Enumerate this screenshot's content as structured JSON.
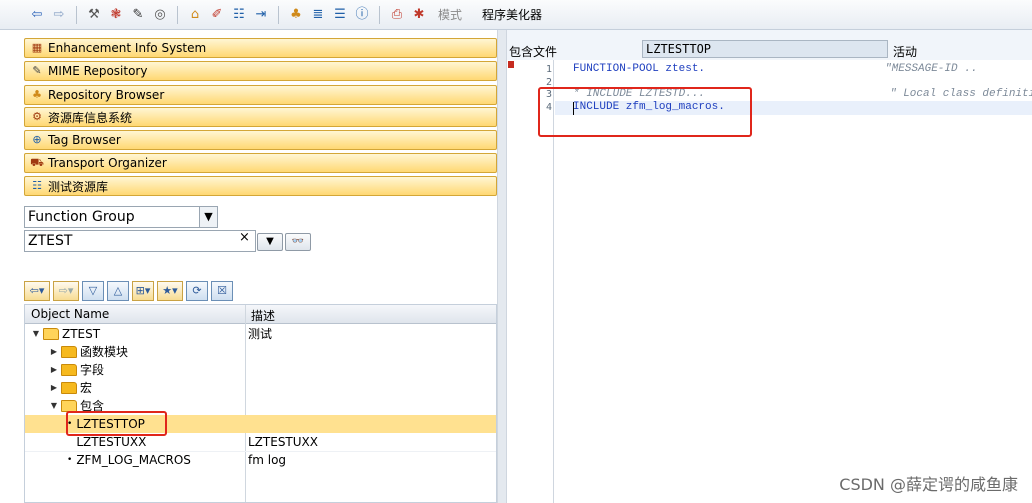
{
  "toolbar": {
    "icons": [
      "back-icon",
      "forward-icon",
      "check-icon",
      "activate-icon",
      "display-change-icon",
      "where-used-icon",
      "hierarchy-icon",
      "edit-icon",
      "object-list-icon",
      "navigate-icon",
      "tree-icon",
      "list-icon",
      "info-icon",
      "print-icon",
      "debug-icon"
    ],
    "mode_label": "模式",
    "pretty_printer_label": "程序美化器"
  },
  "navigator": {
    "items": [
      {
        "label": "Enhancement Info System",
        "icon": "enhancement-icon"
      },
      {
        "label": "MIME Repository",
        "icon": "mime-icon"
      },
      {
        "label": "Repository Browser",
        "icon": "repository-icon"
      },
      {
        "label": "资源库信息系统",
        "icon": "info-system-icon"
      },
      {
        "label": "Tag Browser",
        "icon": "tag-icon"
      },
      {
        "label": "Transport Organizer",
        "icon": "transport-icon"
      },
      {
        "label": "测试资源库",
        "icon": "test-repository-icon"
      }
    ]
  },
  "object_selector": {
    "type_value": "Function Group",
    "name_value": "ZTEST",
    "clear_glyph": "×"
  },
  "tree": {
    "col_name": "Object Name",
    "col_desc": "描述",
    "rows": [
      {
        "name": "ZTEST",
        "desc": "测试",
        "kind": "folder-open",
        "level": 0,
        "toggle": "▼"
      },
      {
        "name": "函数模块",
        "desc": "",
        "kind": "folder",
        "level": 1,
        "toggle": "▶"
      },
      {
        "name": "字段",
        "desc": "",
        "kind": "folder",
        "level": 1,
        "toggle": "▶"
      },
      {
        "name": "宏",
        "desc": "",
        "kind": "folder",
        "level": 1,
        "toggle": "▶"
      },
      {
        "name": "包含",
        "desc": "",
        "kind": "folder-open",
        "level": 1,
        "toggle": "▼"
      },
      {
        "name": "LZTESTTOP",
        "desc": "",
        "kind": "leaf",
        "level": 2,
        "selected": true
      },
      {
        "name": "LZTESTUXX",
        "desc": "LZTESTUXX",
        "kind": "leaf",
        "level": 2
      },
      {
        "name": "ZFM_LOG_MACROS",
        "desc": "fm log",
        "kind": "leaf",
        "level": 2
      }
    ]
  },
  "editor": {
    "include_label": "包含文件",
    "include_value": "LZTESTTOP",
    "status_label": "活动",
    "lines": [
      {
        "no": "1",
        "code": "FUNCTION-POOL ztest.",
        "trail": "\"MESSAGE-ID .."
      },
      {
        "no": "2",
        "code": "",
        "trail": ""
      },
      {
        "no": "3",
        "code": "* INCLUDE LZTESTD...",
        "trail": "\" Local class definiti"
      },
      {
        "no": "4",
        "code": "INCLUDE zfm_log_macros.",
        "trail": ""
      }
    ]
  },
  "watermark": "CSDN @薛定谔的咸鱼康",
  "colors": {
    "accent_red": "#e0261b",
    "nav_button": "#ffd873",
    "selection": "#ffe190"
  }
}
